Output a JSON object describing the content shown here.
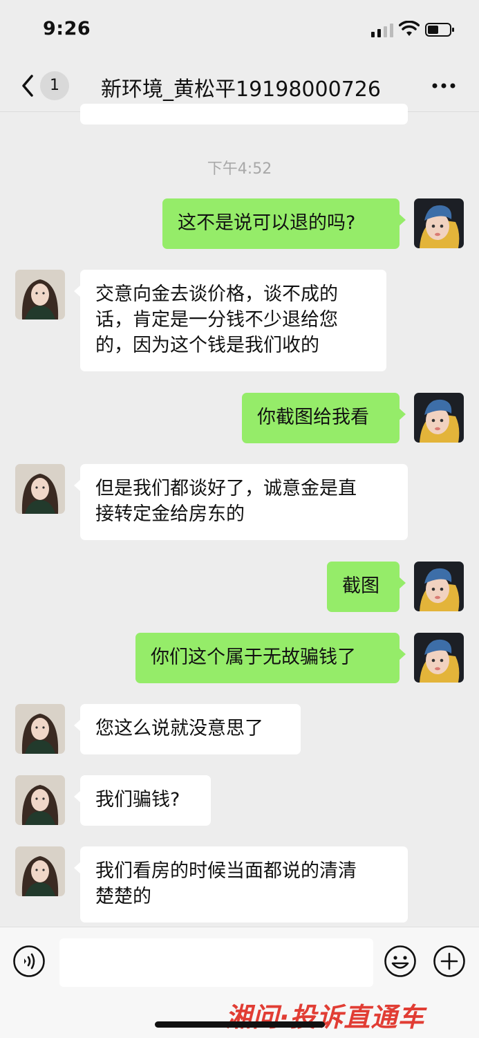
{
  "status_bar": {
    "time": "9:26"
  },
  "nav": {
    "unread_count": "1",
    "title": "新环境_黄松平19198000726"
  },
  "timestamp": "下午4:52",
  "messages": [
    {
      "side": "out",
      "text": "这不是说可以退的吗?"
    },
    {
      "side": "in",
      "lines": [
        "交意向金去谈价格，谈不成的",
        "话，肯定是一分钱不少退给您",
        "的，因为这个钱是我们收的"
      ]
    },
    {
      "side": "out",
      "text": "你截图给我看"
    },
    {
      "side": "in",
      "lines": [
        "但是我们都谈好了，诚意金是直",
        "接转定金给房东的"
      ]
    },
    {
      "side": "out",
      "text": "截图"
    },
    {
      "side": "out",
      "text": "你们这个属于无故骗钱了"
    },
    {
      "side": "in",
      "text": "您这么说就没意思了"
    },
    {
      "side": "in",
      "text": "我们骗钱?"
    },
    {
      "side": "in",
      "lines": [
        "我们看房的时候当面都说的清清",
        "楚楚的"
      ]
    }
  ],
  "input": {
    "placeholder": ""
  },
  "icons": {
    "back": "chevron-left-icon",
    "more": "more-dots-icon",
    "voice": "voice-icon",
    "emoji": "emoji-icon",
    "plus": "plus-icon"
  },
  "watermark": "湘问·投诉直通车",
  "colors": {
    "background": "#ededed",
    "out_bubble": "#95ec69",
    "in_bubble": "#ffffff",
    "watermark": "#e0342a"
  }
}
